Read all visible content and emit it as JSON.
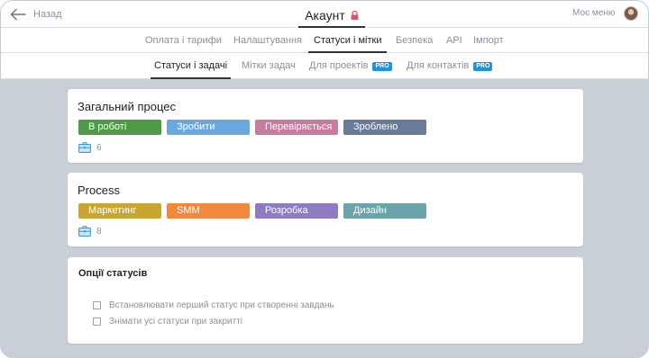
{
  "header": {
    "back_label": "Назад",
    "title": "Акаунт",
    "menu_label": "Моє меню"
  },
  "main_tabs": [
    {
      "label": "Оплата і тарифи",
      "active": false
    },
    {
      "label": "Налаштування",
      "active": false
    },
    {
      "label": "Статуси і мітки",
      "active": true
    },
    {
      "label": "Безпека",
      "active": false
    },
    {
      "label": "API",
      "active": false
    },
    {
      "label": "Імпорт",
      "active": false
    }
  ],
  "sub_tabs": [
    {
      "label": "Статуси і задачі",
      "active": true,
      "badge": ""
    },
    {
      "label": "Мітки задач",
      "active": false,
      "badge": ""
    },
    {
      "label": "Для проектів",
      "active": false,
      "badge": "PRO"
    },
    {
      "label": "Для контактів",
      "active": false,
      "badge": "PRO"
    }
  ],
  "processes": [
    {
      "title": "Загальний процес",
      "statuses": [
        {
          "label": "В роботі",
          "color": "#4e9a47"
        },
        {
          "label": "Зробити",
          "color": "#6aa8dd"
        },
        {
          "label": "Перевіряється",
          "color": "#c97b9e"
        },
        {
          "label": "Зроблено",
          "color": "#6a7a9a"
        }
      ],
      "task_count": "6"
    },
    {
      "title": "Process",
      "statuses": [
        {
          "label": "Маркетинг",
          "color": "#c9a533"
        },
        {
          "label": "SMM",
          "color": "#f0883e"
        },
        {
          "label": "Розробка",
          "color": "#8f7bc2"
        },
        {
          "label": "Дизайн",
          "color": "#6aa3a8"
        }
      ],
      "task_count": "8"
    }
  ],
  "options": {
    "title": "Опції статусів",
    "items": [
      {
        "label": "Встановлювати перший статус при створенні завдань",
        "checked": false
      },
      {
        "label": "Знімати усі статуси при закритті",
        "checked": false
      }
    ]
  },
  "icons": {
    "back": "arrow-left-icon",
    "lock": "lock-icon",
    "tasks": "briefcase-icon"
  },
  "colors": {
    "accent": "#1c94e0",
    "lock": "#e0506a",
    "task_icon": "#3a98d8"
  }
}
